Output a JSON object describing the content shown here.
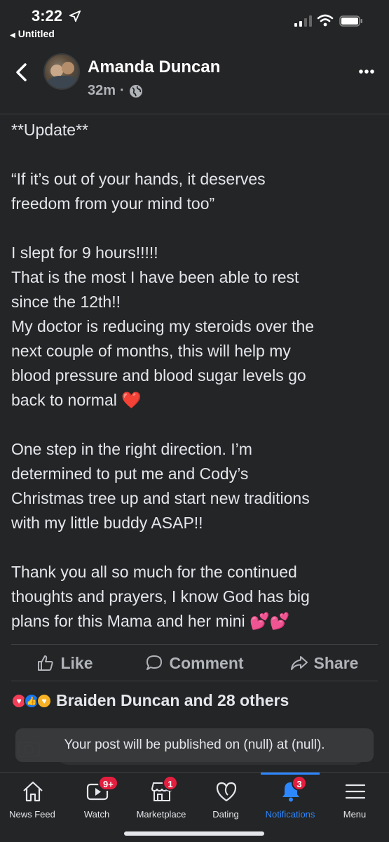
{
  "status_bar": {
    "time": "3:22",
    "back_app": "Untitled"
  },
  "post": {
    "author": "Amanda Duncan",
    "time_ago": "32m",
    "paragraphs": [
      [
        "**Update**"
      ],
      [
        "“If it’s out of your hands, it deserves",
        "freedom from your mind too”"
      ],
      [
        "I slept for 9 hours!!!!!",
        "That is the most I have been able to rest",
        "since the 12th!!",
        "My doctor is reducing my steroids over the",
        "next couple of months, this will help my",
        "blood pressure and blood sugar levels go",
        "back to normal"
      ],
      [
        "One step in the right direction. I’m",
        "determined to put me and Cody’s",
        "Christmas tree up and start new traditions",
        "with my little buddy ASAP!!"
      ],
      [
        "Thank you all so much for the continued",
        "thoughts and prayers, I know God has big",
        "plans for this Mama and her mini"
      ]
    ],
    "emoji_heart": "❤️",
    "emoji_hearts": "💕💕"
  },
  "actions": {
    "like": "Like",
    "comment": "Comment",
    "share": "Share"
  },
  "reactions": {
    "summary": "Braiden Duncan and 28 others",
    "icons": [
      "love-reaction",
      "like-reaction",
      "care-reaction"
    ]
  },
  "toast": {
    "message": "Your post will be published on (null) at (null)."
  },
  "tab_bar": {
    "tabs": [
      {
        "label": "News Feed",
        "icon": "home-icon",
        "badge": ""
      },
      {
        "label": "Watch",
        "icon": "watch-icon",
        "badge": "9+"
      },
      {
        "label": "Marketplace",
        "icon": "marketplace-icon",
        "badge": "1"
      },
      {
        "label": "Dating",
        "icon": "dating-icon",
        "badge": ""
      },
      {
        "label": "Notifications",
        "icon": "bell-icon",
        "badge": "3",
        "active": true
      },
      {
        "label": "Menu",
        "icon": "menu-icon",
        "badge": ""
      }
    ]
  },
  "colors": {
    "background": "#242526",
    "text": "#e4e6eb",
    "secondary_text": "#b0b3b8",
    "accent": "#2d88ff",
    "badge": "#e41e3f"
  }
}
